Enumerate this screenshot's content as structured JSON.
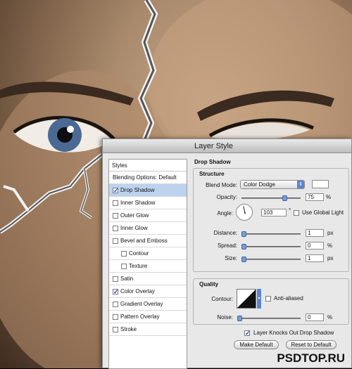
{
  "dialog": {
    "title": "Layer Style",
    "styles_header": "Styles",
    "styles": [
      {
        "label": "Blending Options: Default",
        "checkbox": false,
        "checked": false,
        "selected": false,
        "indent": false
      },
      {
        "label": "Drop Shadow",
        "checkbox": true,
        "checked": true,
        "selected": true,
        "indent": false
      },
      {
        "label": "Inner Shadow",
        "checkbox": true,
        "checked": false,
        "selected": false,
        "indent": false
      },
      {
        "label": "Outer Glow",
        "checkbox": true,
        "checked": false,
        "selected": false,
        "indent": false
      },
      {
        "label": "Inner Glow",
        "checkbox": true,
        "checked": false,
        "selected": false,
        "indent": false
      },
      {
        "label": "Bevel and Emboss",
        "checkbox": true,
        "checked": false,
        "selected": false,
        "indent": false
      },
      {
        "label": "Contour",
        "checkbox": true,
        "checked": false,
        "selected": false,
        "indent": true
      },
      {
        "label": "Texture",
        "checkbox": true,
        "checked": false,
        "selected": false,
        "indent": true
      },
      {
        "label": "Satin",
        "checkbox": true,
        "checked": false,
        "selected": false,
        "indent": false
      },
      {
        "label": "Color Overlay",
        "checkbox": true,
        "checked": true,
        "selected": false,
        "indent": false
      },
      {
        "label": "Gradient Overlay",
        "checkbox": true,
        "checked": false,
        "selected": false,
        "indent": false
      },
      {
        "label": "Pattern Overlay",
        "checkbox": true,
        "checked": false,
        "selected": false,
        "indent": false
      },
      {
        "label": "Stroke",
        "checkbox": true,
        "checked": false,
        "selected": false,
        "indent": false
      }
    ],
    "section_title": "Drop Shadow",
    "structure": {
      "title": "Structure",
      "blend_mode_label": "Blend Mode:",
      "blend_mode_value": "Color Dodge",
      "blend_color": "#ffffff",
      "opacity_label": "Opacity:",
      "opacity_value": "75",
      "opacity_unit": "%",
      "opacity_level": 0.75,
      "angle_label": "Angle:",
      "angle_value": "103",
      "angle_unit": "°",
      "use_global_light_label": "Use Global Light",
      "use_global_light_checked": false,
      "distance_label": "Distance:",
      "distance_value": "1",
      "distance_unit": "px",
      "distance_level": 0.0,
      "spread_label": "Spread:",
      "spread_value": "0",
      "spread_unit": "%",
      "spread_level": 0.0,
      "size_label": "Size:",
      "size_value": "1",
      "size_unit": "px",
      "size_level": 0.0
    },
    "quality": {
      "title": "Quality",
      "contour_label": "Contour:",
      "anti_aliased_label": "Anti-aliased",
      "anti_aliased_checked": false,
      "noise_label": "Noise:",
      "noise_value": "0",
      "noise_unit": "%",
      "noise_level": 0.0
    },
    "knocks_out_label": "Layer Knocks Out Drop Shadow",
    "knocks_out_checked": true,
    "make_default_label": "Make Default",
    "reset_default_label": "Reset to Default"
  },
  "watermark": "PSDTOP.RU",
  "colors": {
    "selection": "#bcd3f0",
    "accent": "#5a86cf",
    "checkmark": "#1b47b3"
  }
}
